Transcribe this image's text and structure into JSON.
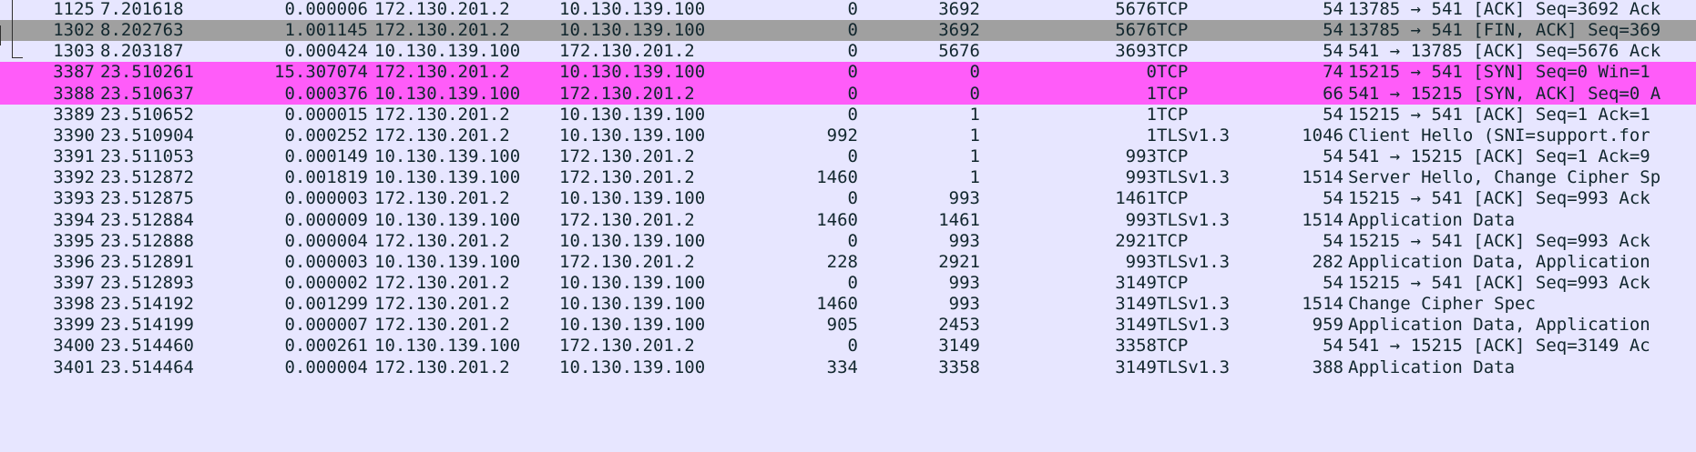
{
  "rows": [
    {
      "no": "1125",
      "time": "7.201618",
      "delta": "0.000006",
      "src": "172.130.201.2",
      "dst": "10.130.139.100",
      "tcp_len": "0",
      "seq": "3692",
      "ack": "5676",
      "proto": "TCP",
      "frame_len": "54",
      "info": "13785 → 541 [ACK] Seq=3692 Ack",
      "flag": "flag-normal"
    },
    {
      "no": "1302",
      "time": "8.202763",
      "delta": "1.001145",
      "src": "172.130.201.2",
      "dst": "10.130.139.100",
      "tcp_len": "0",
      "seq": "3692",
      "ack": "5676",
      "proto": "TCP",
      "frame_len": "54",
      "info": "13785 → 541 [FIN, ACK] Seq=369",
      "flag": "flag-selected"
    },
    {
      "no": "1303",
      "time": "8.203187",
      "delta": "0.000424",
      "src": "10.130.139.100",
      "dst": "172.130.201.2",
      "tcp_len": "0",
      "seq": "5676",
      "ack": "3693",
      "proto": "TCP",
      "frame_len": "54",
      "info": "541 → 13785 [ACK] Seq=5676 Ack",
      "flag": "flag-normal"
    },
    {
      "no": "3387",
      "time": "23.510261",
      "delta": "15.307074",
      "src": "172.130.201.2",
      "dst": "10.130.139.100",
      "tcp_len": "0",
      "seq": "0",
      "ack": "0",
      "proto": "TCP",
      "frame_len": "74",
      "info": "15215 → 541 [SYN] Seq=0 Win=1",
      "flag": "flag-syn"
    },
    {
      "no": "3388",
      "time": "23.510637",
      "delta": "0.000376",
      "src": "10.130.139.100",
      "dst": "172.130.201.2",
      "tcp_len": "0",
      "seq": "0",
      "ack": "1",
      "proto": "TCP",
      "frame_len": "66",
      "info": "541 → 15215 [SYN, ACK] Seq=0 A",
      "flag": "flag-syn"
    },
    {
      "no": "3389",
      "time": "23.510652",
      "delta": "0.000015",
      "src": "172.130.201.2",
      "dst": "10.130.139.100",
      "tcp_len": "0",
      "seq": "1",
      "ack": "1",
      "proto": "TCP",
      "frame_len": "54",
      "info": "15215 → 541 [ACK] Seq=1 Ack=1",
      "flag": "flag-normal"
    },
    {
      "no": "3390",
      "time": "23.510904",
      "delta": "0.000252",
      "src": "172.130.201.2",
      "dst": "10.130.139.100",
      "tcp_len": "992",
      "seq": "1",
      "ack": "1",
      "proto": "TLSv1.3",
      "frame_len": "1046",
      "info": "Client Hello (SNI=support.for",
      "flag": "flag-normal"
    },
    {
      "no": "3391",
      "time": "23.511053",
      "delta": "0.000149",
      "src": "10.130.139.100",
      "dst": "172.130.201.2",
      "tcp_len": "0",
      "seq": "1",
      "ack": "993",
      "proto": "TCP",
      "frame_len": "54",
      "info": "541 → 15215 [ACK] Seq=1 Ack=9",
      "flag": "flag-normal"
    },
    {
      "no": "3392",
      "time": "23.512872",
      "delta": "0.001819",
      "src": "10.130.139.100",
      "dst": "172.130.201.2",
      "tcp_len": "1460",
      "seq": "1",
      "ack": "993",
      "proto": "TLSv1.3",
      "frame_len": "1514",
      "info": "Server Hello, Change Cipher Sp",
      "flag": "flag-normal"
    },
    {
      "no": "3393",
      "time": "23.512875",
      "delta": "0.000003",
      "src": "172.130.201.2",
      "dst": "10.130.139.100",
      "tcp_len": "0",
      "seq": "993",
      "ack": "1461",
      "proto": "TCP",
      "frame_len": "54",
      "info": "15215 → 541 [ACK] Seq=993 Ack",
      "flag": "flag-normal"
    },
    {
      "no": "3394",
      "time": "23.512884",
      "delta": "0.000009",
      "src": "10.130.139.100",
      "dst": "172.130.201.2",
      "tcp_len": "1460",
      "seq": "1461",
      "ack": "993",
      "proto": "TLSv1.3",
      "frame_len": "1514",
      "info": "Application Data",
      "flag": "flag-normal"
    },
    {
      "no": "3395",
      "time": "23.512888",
      "delta": "0.000004",
      "src": "172.130.201.2",
      "dst": "10.130.139.100",
      "tcp_len": "0",
      "seq": "993",
      "ack": "2921",
      "proto": "TCP",
      "frame_len": "54",
      "info": "15215 → 541 [ACK] Seq=993 Ack",
      "flag": "flag-normal"
    },
    {
      "no": "3396",
      "time": "23.512891",
      "delta": "0.000003",
      "src": "10.130.139.100",
      "dst": "172.130.201.2",
      "tcp_len": "228",
      "seq": "2921",
      "ack": "993",
      "proto": "TLSv1.3",
      "frame_len": "282",
      "info": "Application Data, Application",
      "flag": "flag-normal"
    },
    {
      "no": "3397",
      "time": "23.512893",
      "delta": "0.000002",
      "src": "172.130.201.2",
      "dst": "10.130.139.100",
      "tcp_len": "0",
      "seq": "993",
      "ack": "3149",
      "proto": "TCP",
      "frame_len": "54",
      "info": "15215 → 541 [ACK] Seq=993 Ack",
      "flag": "flag-normal"
    },
    {
      "no": "3398",
      "time": "23.514192",
      "delta": "0.001299",
      "src": "172.130.201.2",
      "dst": "10.130.139.100",
      "tcp_len": "1460",
      "seq": "993",
      "ack": "3149",
      "proto": "TLSv1.3",
      "frame_len": "1514",
      "info": "Change Cipher Spec",
      "flag": "flag-normal"
    },
    {
      "no": "3399",
      "time": "23.514199",
      "delta": "0.000007",
      "src": "172.130.201.2",
      "dst": "10.130.139.100",
      "tcp_len": "905",
      "seq": "2453",
      "ack": "3149",
      "proto": "TLSv1.3",
      "frame_len": "959",
      "info": "Application Data, Application",
      "flag": "flag-normal"
    },
    {
      "no": "3400",
      "time": "23.514460",
      "delta": "0.000261",
      "src": "10.130.139.100",
      "dst": "172.130.201.2",
      "tcp_len": "0",
      "seq": "3149",
      "ack": "3358",
      "proto": "TCP",
      "frame_len": "54",
      "info": "541 → 15215 [ACK] Seq=3149 Ac",
      "flag": "flag-normal"
    },
    {
      "no": "3401",
      "time": "23.514464",
      "delta": "0.000004",
      "src": "172.130.201.2",
      "dst": "10.130.139.100",
      "tcp_len": "334",
      "seq": "3358",
      "ack": "3149",
      "proto": "TLSv1.3",
      "frame_len": "388",
      "info": "Application Data",
      "flag": "flag-normal"
    }
  ],
  "colors": {
    "normal_row": "#e7e6ff",
    "selected_row": "#a0a0a0",
    "syn_row": "#ff5cf9",
    "text": "#12272e"
  }
}
